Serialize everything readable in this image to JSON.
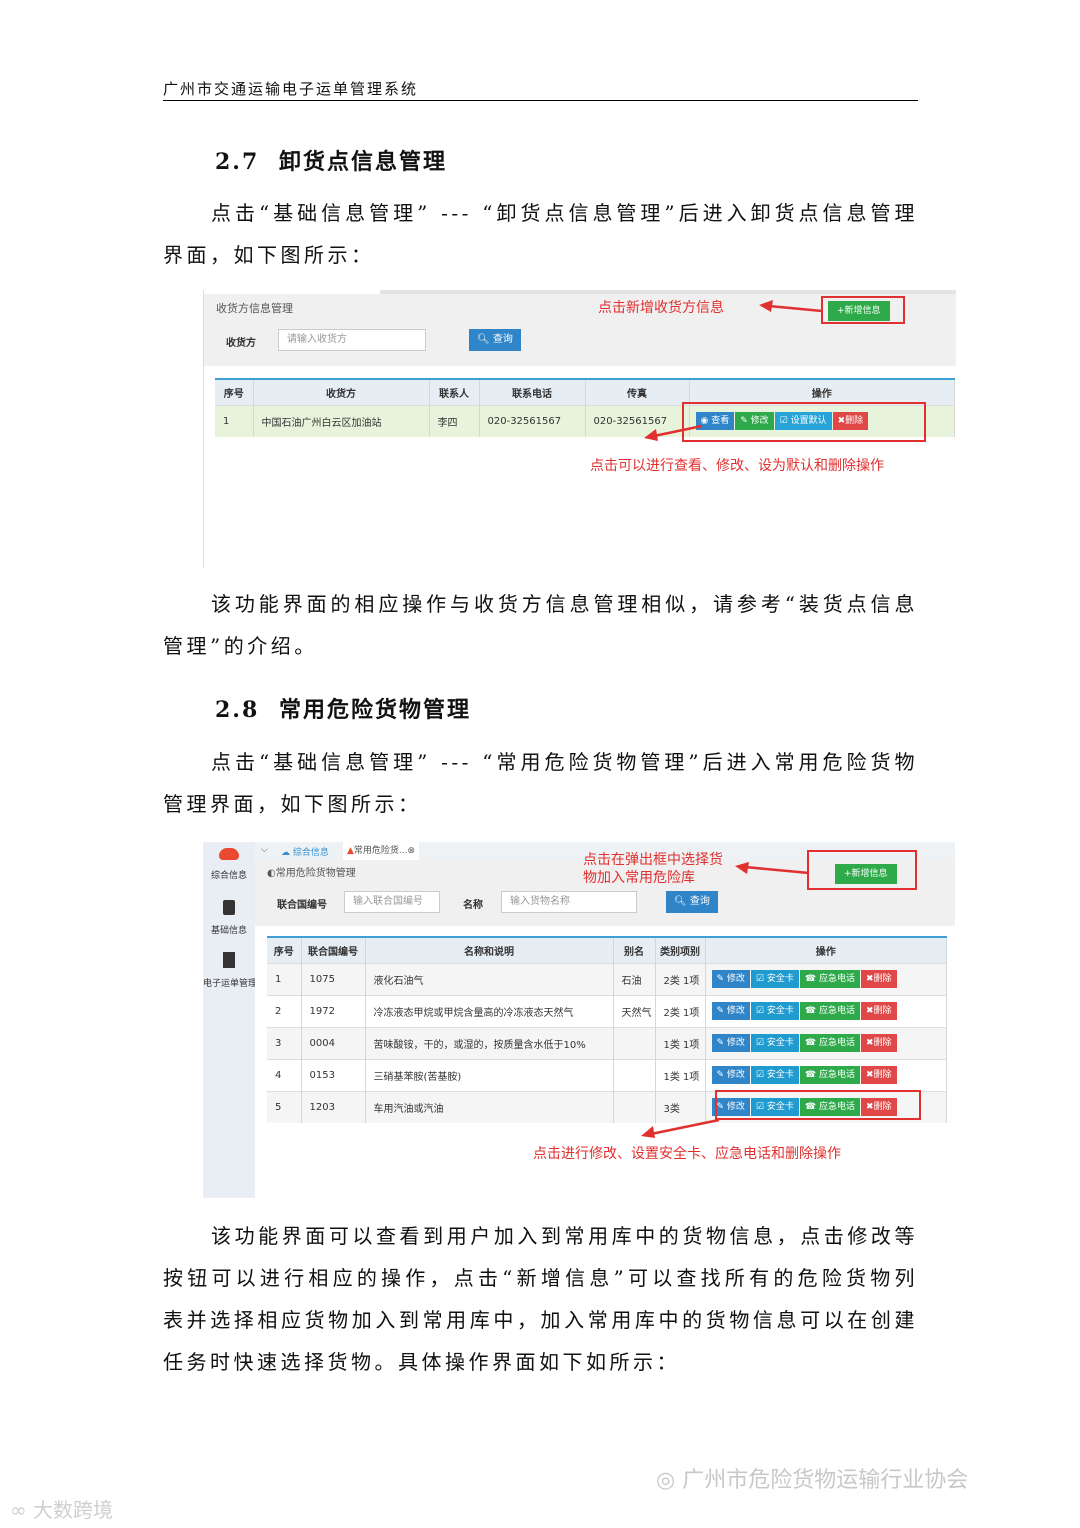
{
  "header": {
    "title": "广州市交通运输电子运单管理系统"
  },
  "section27": {
    "number": "2.7",
    "title": "卸货点信息管理",
    "intro": "点击“基础信息管理” --- “卸货点信息管理”后进入卸货点信息管理界面，如下图所示：",
    "outro": "该功能界面的相应操作与收货方信息管理相似，请参考“装货点信息管理”的介绍。"
  },
  "shot1": {
    "breadcrumb": "收货方信息管理",
    "search_label": "收货方",
    "search_placeholder": "请输入收货方",
    "query_label": "查询",
    "add_label": "+新增信息",
    "note_add": "点击新增收货方信息",
    "note_ops": "点击可以进行查看、修改、设为默认和删除操作",
    "columns": [
      "序号",
      "收货方",
      "联系人",
      "联系电话",
      "传真",
      "操作"
    ],
    "row": {
      "no": "1",
      "name": "中国石油广州白云区加油站",
      "contact": "李四",
      "phone": "020-32561567",
      "fax": "020-32561567"
    },
    "buttons": {
      "view": "查看",
      "edit": "修改",
      "default": "设置默认",
      "delete": "删除"
    }
  },
  "section28": {
    "number": "2.8",
    "title": "常用危险货物管理",
    "intro": "点击“基础信息管理” --- “常用危险货物管理”后进入常用危险货物管理界面，如下图所示：",
    "outro": "该功能界面可以查看到用户加入到常用库中的货物信息，点击修改等按钮可以进行相应的操作，点击“新增信息”可以查找所有的危险货物列表并选择相应货物加入到常用库中，加入常用库中的货物信息可以在创建任务时快速选择货物。具体操作界面如下如所示："
  },
  "shot2": {
    "sidebar": [
      "综合信息",
      "基础信息",
      "电子运单管理"
    ],
    "tab1": "综合信息",
    "tab2": "常用危险货...",
    "breadcrumb": "常用危险货物管理",
    "un_label": "联合国编号",
    "un_placeholder": "输入联合国编号",
    "name_label": "名称",
    "name_placeholder": "输入货物名称",
    "query_label": "查询",
    "add_label": "+新增信息",
    "note_add_1": "点击在弹出框中选择货",
    "note_add_2": "物加入常用危险库",
    "note_ops": "点击进行修改、设置安全卡、应急电话和删除操作",
    "columns": [
      "序号",
      "联合国编号",
      "名称和说明",
      "别名",
      "类别项别",
      "操作"
    ],
    "rows": [
      {
        "no": "1",
        "un": "1075",
        "name": "液化石油气",
        "alias": "石油",
        "cls": "2类 1项"
      },
      {
        "no": "2",
        "un": "1972",
        "name": "冷冻液态甲烷或甲烷含量高的冷冻液态天然气",
        "alias": "天然气",
        "cls": "2类 1项"
      },
      {
        "no": "3",
        "un": "0004",
        "name": "苦味酸铵，干的，或湿的，按质量含水低于10%",
        "alias": "",
        "cls": "1类 1项"
      },
      {
        "no": "4",
        "un": "0153",
        "name": "三硝基苯胺(苦基胺)",
        "alias": "",
        "cls": "1类 1项"
      },
      {
        "no": "5",
        "un": "1203",
        "name": "车用汽油或汽油",
        "alias": "",
        "cls": "3类"
      }
    ],
    "buttons": {
      "edit": "修改",
      "card": "安全卡",
      "phone": "应急电话",
      "delete": "删除"
    }
  },
  "watermarks": {
    "right": "广州市危险货物运输行业协会",
    "left": "大数跨境"
  }
}
